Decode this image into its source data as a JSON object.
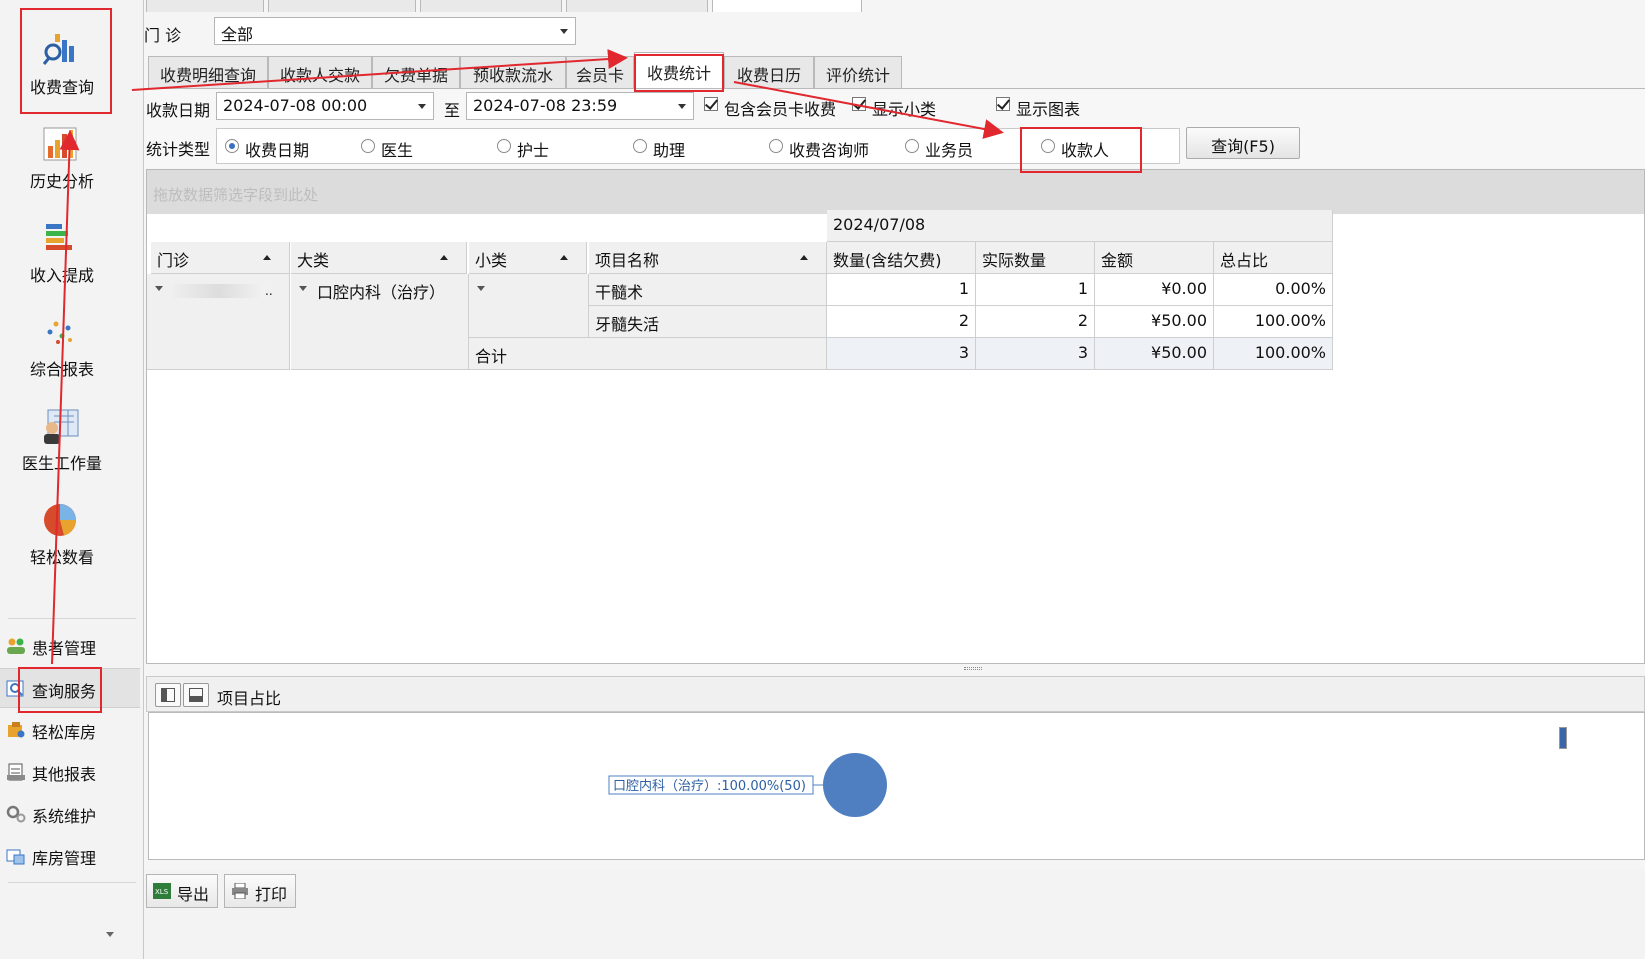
{
  "sidebar": {
    "big_items": [
      {
        "label": "收费查询",
        "icon": "search-chart-icon"
      },
      {
        "label": "历史分析",
        "icon": "bar-chart-icon"
      },
      {
        "label": "收入提成",
        "icon": "stacked-bars-icon"
      },
      {
        "label": "综合报表",
        "icon": "scatter-dots-icon"
      },
      {
        "label": "医生工作量",
        "icon": "doctor-icon"
      },
      {
        "label": "轻松数看",
        "icon": "pie-chart-icon"
      }
    ],
    "small_items": [
      {
        "label": "患者管理",
        "icon": "patients-icon"
      },
      {
        "label": "查询服务",
        "icon": "query-service-icon",
        "selected": true
      },
      {
        "label": "轻松库房",
        "icon": "warehouse-icon"
      },
      {
        "label": "其他报表",
        "icon": "report-icon"
      },
      {
        "label": "系统维护",
        "icon": "gears-icon"
      },
      {
        "label": "库房管理",
        "icon": "inventory-icon"
      }
    ]
  },
  "clinic": {
    "label": "门  诊",
    "value": "全部"
  },
  "subtabs": [
    {
      "label": "收费明细查询"
    },
    {
      "label": "收款人交款"
    },
    {
      "label": "欠费单据"
    },
    {
      "label": "预收款流水"
    },
    {
      "label": "会员卡"
    },
    {
      "label": "收费统计",
      "active": true
    },
    {
      "label": "收费日历"
    },
    {
      "label": "评价统计"
    }
  ],
  "filters": {
    "date_label": "收款日期",
    "date_from": "2024-07-08 00:00",
    "to_label": "至",
    "date_to": "2024-07-08 23:59",
    "checks": [
      "包含会员卡收费",
      "显示小类",
      "显示图表"
    ],
    "stat_type_label": "统计类型",
    "stat_types": [
      {
        "label": "收费日期",
        "selected": true
      },
      {
        "label": "医生"
      },
      {
        "label": "护士"
      },
      {
        "label": "助理"
      },
      {
        "label": "收费咨询师"
      },
      {
        "label": "业务员"
      },
      {
        "label": "收款人"
      }
    ],
    "query_button": "查询(F5)"
  },
  "grid": {
    "drop_hint": "拖放数据筛选字段到此处",
    "date_header": "2024/07/08",
    "row_headers": [
      "门诊",
      "大类",
      "小类",
      "项目名称"
    ],
    "value_headers": [
      "数量(含结欠费)",
      "实际数量",
      "金额",
      "总占比"
    ],
    "category": "口腔内科（治疗）",
    "rows": [
      {
        "name": "干髓术",
        "qty": "1",
        "actual": "1",
        "amount": "¥0.00",
        "ratio": "0.00%"
      },
      {
        "name": "牙髓失活",
        "qty": "2",
        "actual": "2",
        "amount": "¥50.00",
        "ratio": "100.00%"
      }
    ],
    "total": {
      "label": "合计",
      "qty": "3",
      "actual": "3",
      "amount": "¥50.00",
      "ratio": "100.00%"
    }
  },
  "chart_panel": {
    "title": "项目占比",
    "slice_label": "口腔内科（治疗）:100.00%(50)"
  },
  "chart_data": {
    "type": "pie",
    "categories": [
      "口腔内科（治疗）"
    ],
    "values": [
      50
    ],
    "percent": [
      100.0
    ],
    "colors": [
      "#4f7fc0"
    ]
  },
  "footer": {
    "export_label": "导出",
    "print_label": "打印"
  },
  "colors": {
    "accent": "#3a6fc0",
    "annotation": "#e0282e",
    "pie": "#4f7fc0"
  }
}
